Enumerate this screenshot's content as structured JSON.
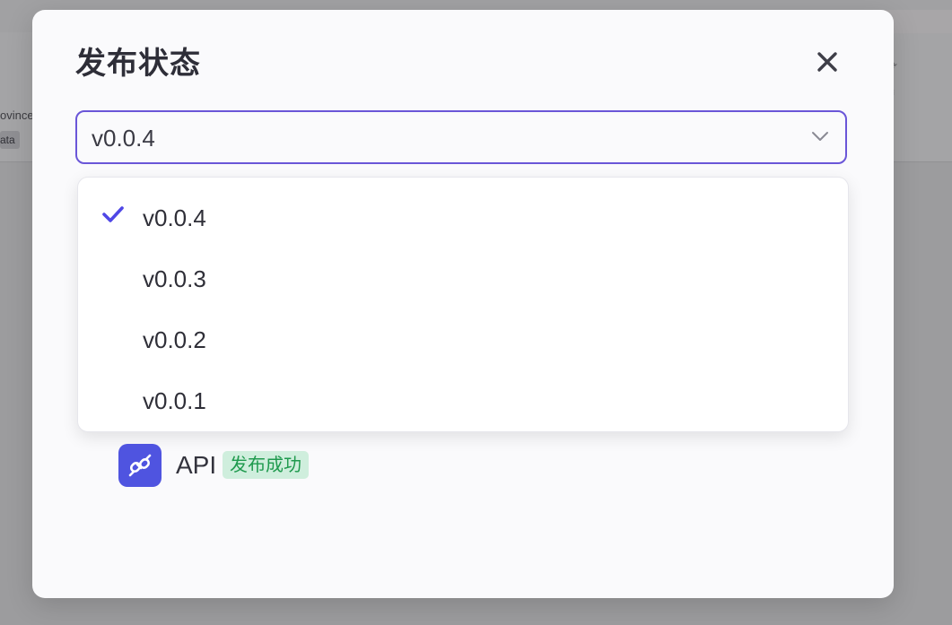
{
  "background": {
    "fragment_1": "ovince",
    "fragment_2": "ata"
  },
  "modal": {
    "title": "发布状态",
    "close_icon": "close-icon"
  },
  "version_select": {
    "value": "v0.0.4",
    "chevron_icon": "chevron-down-icon",
    "options": [
      {
        "label": "v0.0.4",
        "selected": true
      },
      {
        "label": "v0.0.3",
        "selected": false
      },
      {
        "label": "v0.0.2",
        "selected": false
      },
      {
        "label": "v0.0.1",
        "selected": false
      }
    ]
  },
  "publish_target": {
    "icon": "plug-link-icon",
    "label": "API",
    "status": "发布成功"
  },
  "colors": {
    "accent": "#6a56d8",
    "check": "#4f47e6",
    "api_icon_bg": "#4f54e0",
    "badge_bg": "#cfeedd",
    "badge_text": "#1f9a4e"
  }
}
